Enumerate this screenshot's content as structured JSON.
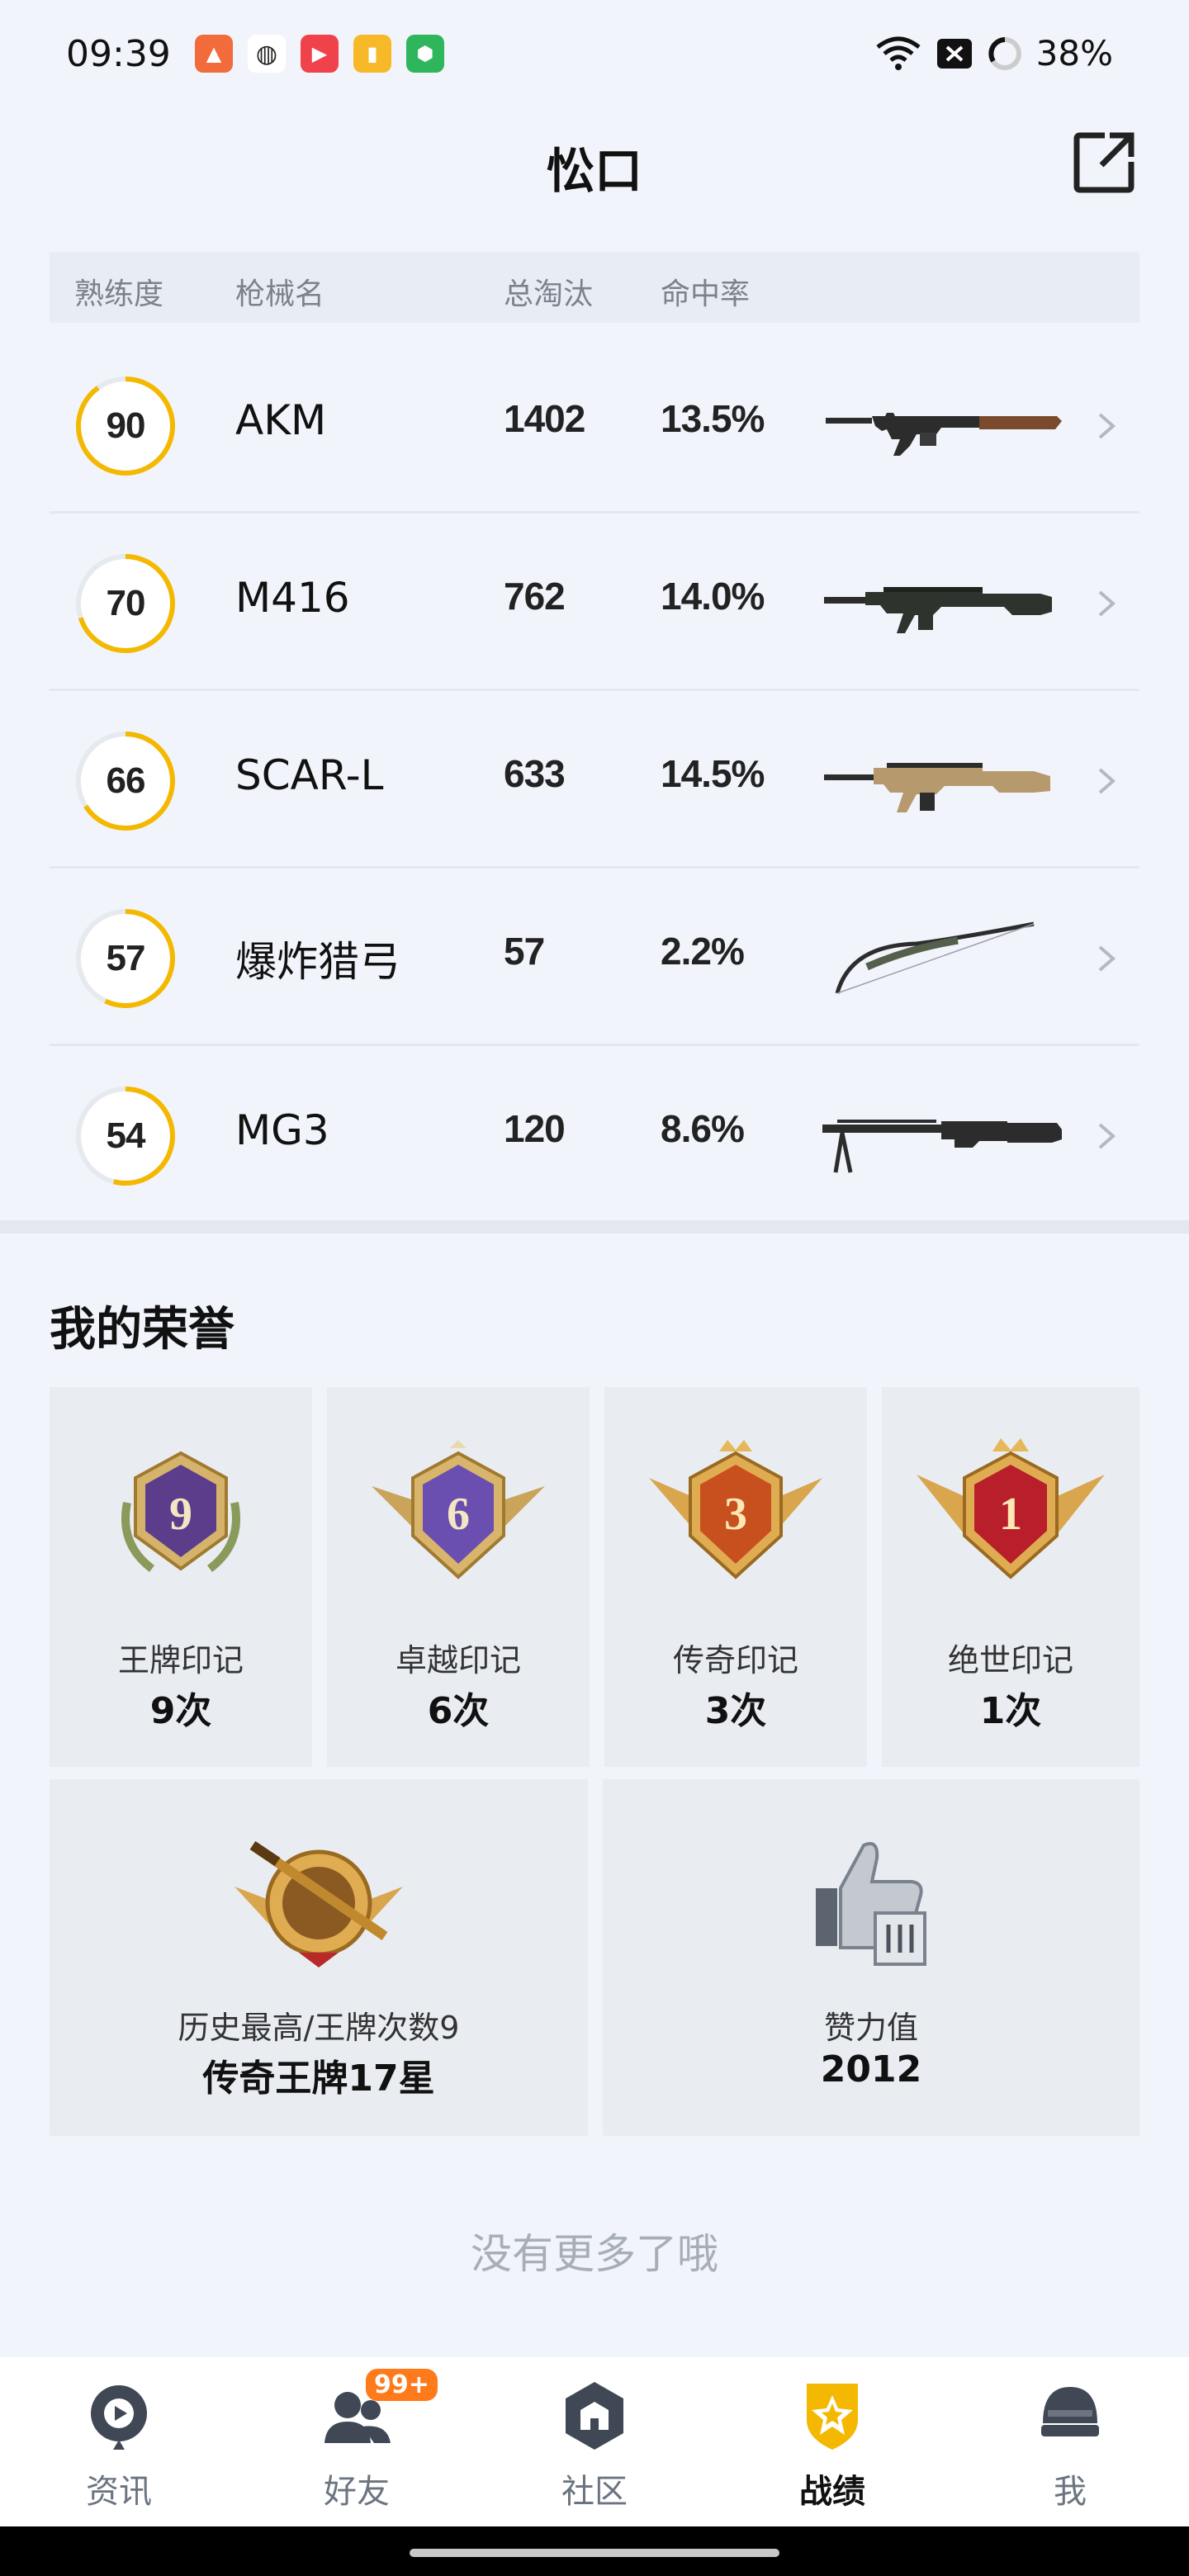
{
  "status_bar": {
    "time": "09:39",
    "battery": "38%"
  },
  "header": {
    "title": "忪口"
  },
  "table": {
    "headers": {
      "proficiency": "熟练度",
      "gun_name": "枪械名",
      "kills": "总淘汰",
      "accuracy": "命中率"
    },
    "rows": [
      {
        "proficiency": "90",
        "name": "AKM",
        "kills": "1402",
        "accuracy": "13.5%",
        "icon": "akm-rifle-icon"
      },
      {
        "proficiency": "70",
        "name": "M416",
        "kills": "762",
        "accuracy": "14.0%",
        "icon": "m416-rifle-icon"
      },
      {
        "proficiency": "66",
        "name": "SCAR-L",
        "kills": "633",
        "accuracy": "14.5%",
        "icon": "scar-l-rifle-icon"
      },
      {
        "proficiency": "57",
        "name": "爆炸猎弓",
        "kills": "57",
        "accuracy": "2.2%",
        "icon": "bow-icon"
      },
      {
        "proficiency": "54",
        "name": "MG3",
        "kills": "120",
        "accuracy": "8.6%",
        "icon": "mg3-machinegun-icon"
      }
    ]
  },
  "honors": {
    "title": "我的荣誉",
    "small_cards": [
      {
        "label": "王牌印记",
        "value": "9次",
        "medal_number": "9"
      },
      {
        "label": "卓越印记",
        "value": "6次",
        "medal_number": "6"
      },
      {
        "label": "传奇印记",
        "value": "3次",
        "medal_number": "3"
      },
      {
        "label": "绝世印记",
        "value": "1次",
        "medal_number": "1"
      }
    ],
    "big_cards": [
      {
        "label": "历史最高/王牌次数9",
        "value": "传奇王牌17星",
        "icon": "legend-ace-medal-icon"
      },
      {
        "label": "赞力值",
        "value": "2012",
        "icon": "thumbs-up-trophy-icon"
      }
    ]
  },
  "footer": {
    "no_more": "没有更多了哦"
  },
  "bottom_nav": {
    "items": [
      {
        "label": "资讯",
        "icon": "news-icon"
      },
      {
        "label": "好友",
        "icon": "friends-icon",
        "badge": "99+"
      },
      {
        "label": "社区",
        "icon": "community-icon"
      },
      {
        "label": "战绩",
        "icon": "record-icon",
        "active": true
      },
      {
        "label": "我",
        "icon": "profile-helmet-icon"
      }
    ]
  },
  "colors": {
    "accent": "#f5b800",
    "background": "#f1f5fb",
    "badge": "#ff7a1a"
  }
}
